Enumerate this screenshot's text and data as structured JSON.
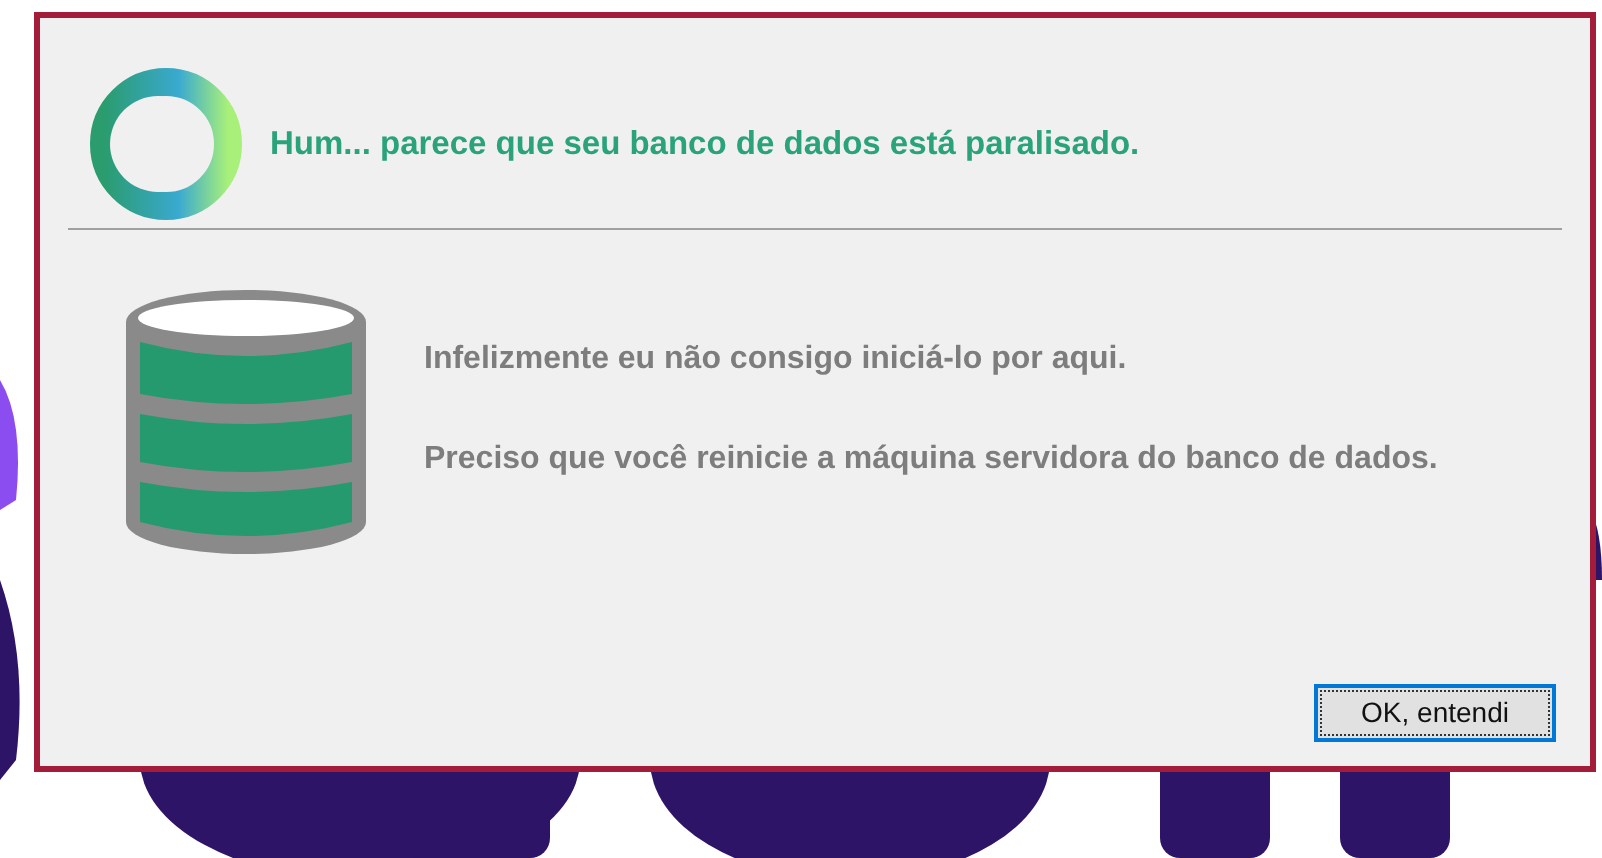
{
  "dialog": {
    "heading": "Hum... parece que seu banco de dados está paralisado.",
    "messages": [
      "Infelizmente eu não consigo iniciá-lo por aqui.",
      "Preciso que você reinicie a máquina servidora do banco de dados."
    ],
    "buttons": [
      {
        "label": "OK, entendi",
        "focused": true
      }
    ]
  }
}
